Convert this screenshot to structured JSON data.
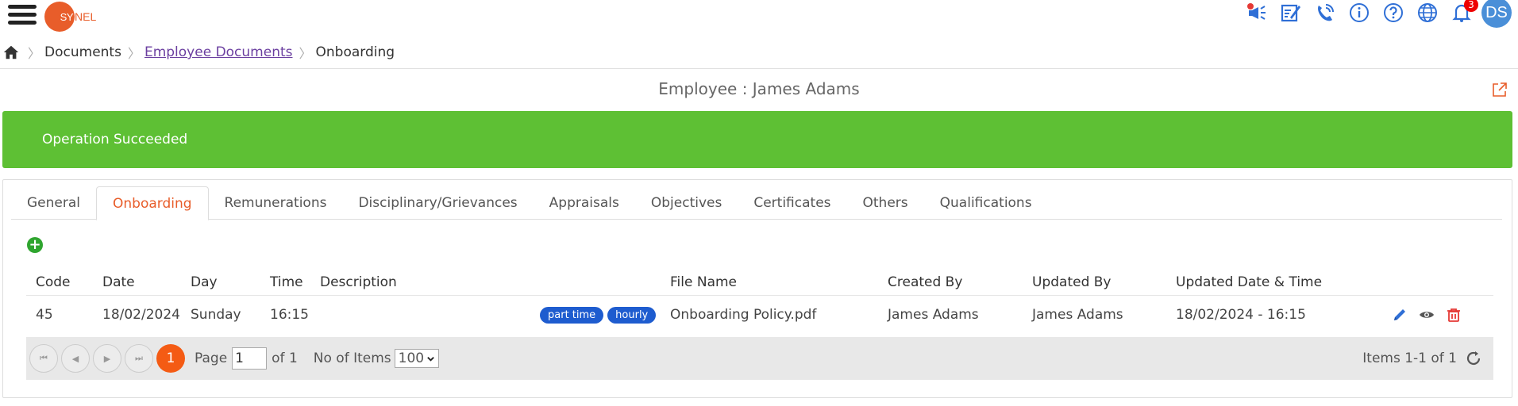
{
  "header": {
    "logo_a": "SY",
    "logo_b": "NEL",
    "notification_count": "3",
    "user_initials": "DS",
    "icons": [
      "megaphone-icon",
      "edit-form-icon",
      "phone-icon",
      "info-icon",
      "help-icon",
      "globe-icon",
      "bell-icon"
    ]
  },
  "breadcrumb": {
    "items": [
      "Documents",
      "Employee Documents",
      "Onboarding"
    ]
  },
  "page": {
    "title": "Employee : James Adams"
  },
  "alert": {
    "message": "Operation Succeeded"
  },
  "tabs": [
    {
      "label": "General",
      "active": false
    },
    {
      "label": "Onboarding",
      "active": true
    },
    {
      "label": "Remunerations",
      "active": false
    },
    {
      "label": "Disciplinary/Grievances",
      "active": false
    },
    {
      "label": "Appraisals",
      "active": false
    },
    {
      "label": "Objectives",
      "active": false
    },
    {
      "label": "Certificates",
      "active": false
    },
    {
      "label": "Others",
      "active": false
    },
    {
      "label": "Qualifications",
      "active": false
    }
  ],
  "grid": {
    "columns": [
      "Code",
      "Date",
      "Day",
      "Time",
      "Description",
      "File Name",
      "Created By",
      "Updated By",
      "Updated Date & Time"
    ],
    "rows": [
      {
        "code": "45",
        "date": "18/02/2024",
        "day": "Sunday",
        "time": "16:15",
        "description": "",
        "tags": [
          "part time",
          "hourly"
        ],
        "file_name": "Onboarding Policy.pdf",
        "created_by": "James Adams",
        "updated_by": "James Adams",
        "updated_datetime": "18/02/2024 - 16:15"
      }
    ]
  },
  "pager": {
    "current_page": "1",
    "page_label": "Page",
    "page_value": "1",
    "of_label": "of 1",
    "items_label": "No of Items",
    "items_value": "100",
    "summary": "Items 1-1 of 1"
  },
  "colors": {
    "accent": "#e85d2a",
    "success": "#5ec034",
    "tag": "#1e5ccf",
    "icon_blue": "#2f6fd6",
    "delete_red": "#e53935"
  }
}
